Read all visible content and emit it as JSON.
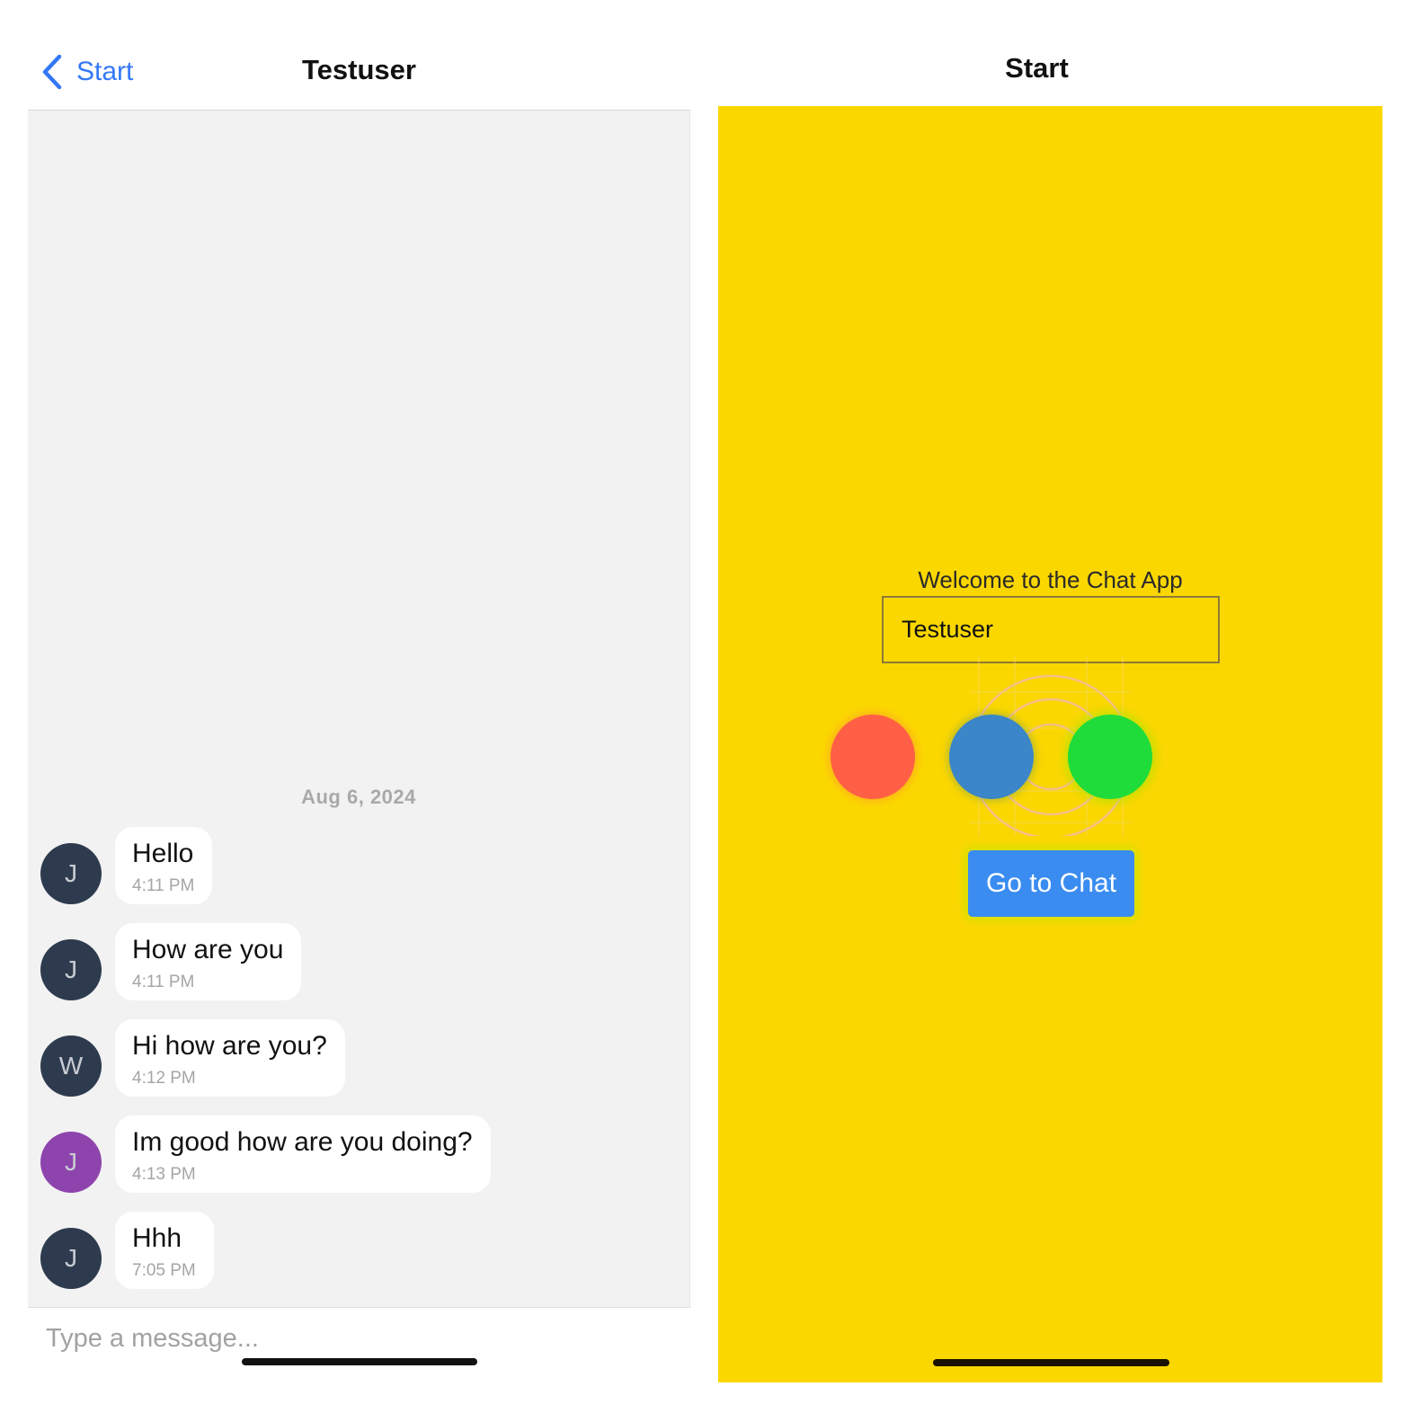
{
  "chat": {
    "back_label": "Start",
    "title": "Testuser",
    "date_separator": "Aug 6, 2024",
    "messages": [
      {
        "avatar_letter": "J",
        "avatar_color": "#2e3b4e",
        "text": "Hello",
        "time": "4:11 PM"
      },
      {
        "avatar_letter": "J",
        "avatar_color": "#2e3b4e",
        "text": "How are you",
        "time": "4:11 PM"
      },
      {
        "avatar_letter": "W",
        "avatar_color": "#2e3b4e",
        "text": "Hi how are you?",
        "time": "4:12 PM"
      },
      {
        "avatar_letter": "J",
        "avatar_color": "#8e44ad",
        "text": "Im good how are you doing?",
        "time": "4:13 PM"
      },
      {
        "avatar_letter": "J",
        "avatar_color": "#2e3b4e",
        "text": "Hhh",
        "time": "7:05 PM"
      }
    ],
    "composer_placeholder": "Type a message..."
  },
  "start": {
    "title": "Start",
    "background_color": "#fbd700",
    "welcome_text": "Welcome to the Chat App",
    "name_value": "Testuser",
    "color_options": [
      {
        "name": "red",
        "color": "#ff5f45"
      },
      {
        "name": "blue",
        "color": "#3a86c8"
      },
      {
        "name": "green",
        "color": "#1fdc3a"
      }
    ],
    "go_button_label": "Go to Chat"
  },
  "colors": {
    "accent_blue": "#3478f6",
    "chat_bg": "#f2f2f2"
  }
}
